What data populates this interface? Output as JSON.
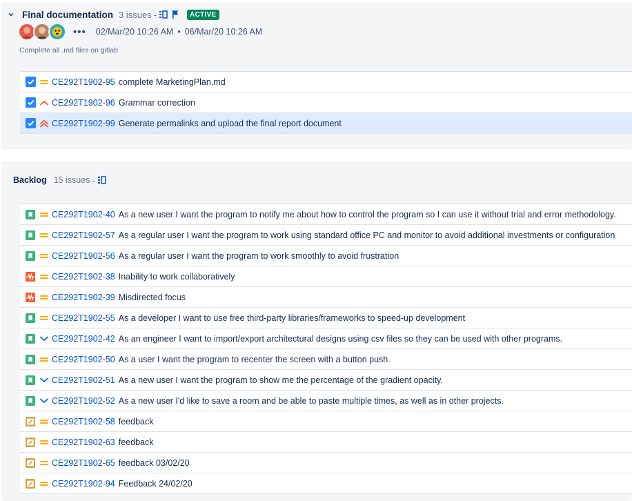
{
  "sprint": {
    "title": "Final documentation",
    "issue_count": "3 issues",
    "dash": "-",
    "status": "ACTIVE",
    "more": "•••",
    "start_date": "02/Mar/20 10:26 AM",
    "date_separator": "•",
    "end_date": "06/Mar/20 10:26 AM",
    "goal": "Complete all .md files on gitlab",
    "issues": [
      {
        "type": "task",
        "priority": "medium",
        "key": "CE292T1902-95",
        "summary": "complete MarketingPlan.md"
      },
      {
        "type": "task",
        "priority": "high",
        "key": "CE292T1902-96",
        "summary": "Grammar correction"
      },
      {
        "type": "task",
        "priority": "highest",
        "key": "CE292T1902-99",
        "summary": "Generate permalinks and upload the final report document"
      }
    ]
  },
  "backlog": {
    "title": "Backlog",
    "issue_count": "15 issues",
    "dash": "-",
    "issues": [
      {
        "type": "story",
        "priority": "medium",
        "key": "CE292T1902-40",
        "summary": "As a new user I want the program to notify me about how to control the program so I can use it without trial and error methodology."
      },
      {
        "type": "story",
        "priority": "medium",
        "key": "CE292T1902-57",
        "summary": "As a regular user I want the program to work using standard office PC and monitor to avoid additional investments or configuration"
      },
      {
        "type": "story",
        "priority": "medium",
        "key": "CE292T1902-56",
        "summary": "As a regular user I want the program to work smoothly to avoid frustration"
      },
      {
        "type": "risk",
        "priority": "medium",
        "key": "CE292T1902-38",
        "summary": "Inability to work collaboratively"
      },
      {
        "type": "risk",
        "priority": "medium",
        "key": "CE292T1902-39",
        "summary": "Misdirected focus"
      },
      {
        "type": "story",
        "priority": "medium",
        "key": "CE292T1902-55",
        "summary": "As a developer I want to use free third-party libraries/frameworks to speed-up development"
      },
      {
        "type": "story",
        "priority": "low",
        "key": "CE292T1902-42",
        "summary": "As an engineer I want to import/export architectural designs using csv files so they can be used with other programs."
      },
      {
        "type": "story",
        "priority": "medium",
        "key": "CE292T1902-50",
        "summary": "As a user I want the program to recenter the screen with a button push."
      },
      {
        "type": "story",
        "priority": "low",
        "key": "CE292T1902-51",
        "summary": "As a new user I want the program to show me the percentage of the gradient opacity."
      },
      {
        "type": "story",
        "priority": "low",
        "key": "CE292T1902-52",
        "summary": "As a new user I'd like to save a room and be able to paste multiple times, as well as in other projects."
      },
      {
        "type": "feedback",
        "priority": "medium",
        "key": "CE292T1902-58",
        "summary": "feedback"
      },
      {
        "type": "feedback",
        "priority": "medium",
        "key": "CE292T1902-63",
        "summary": "feedback"
      },
      {
        "type": "feedback",
        "priority": "medium",
        "key": "CE292T1902-65",
        "summary": "feedback 03/02/20"
      },
      {
        "type": "feedback",
        "priority": "medium",
        "key": "CE292T1902-94",
        "summary": "Feedback 24/02/20"
      }
    ]
  },
  "colors": {
    "task": "#2684ff",
    "story": "#36b37e",
    "risk": "#ff5630",
    "feedback": "#d4a243",
    "priority_medium": "#ffab00",
    "priority_high": "#ff5630",
    "priority_low": "#0065ff",
    "active_badge": "#00875a"
  }
}
